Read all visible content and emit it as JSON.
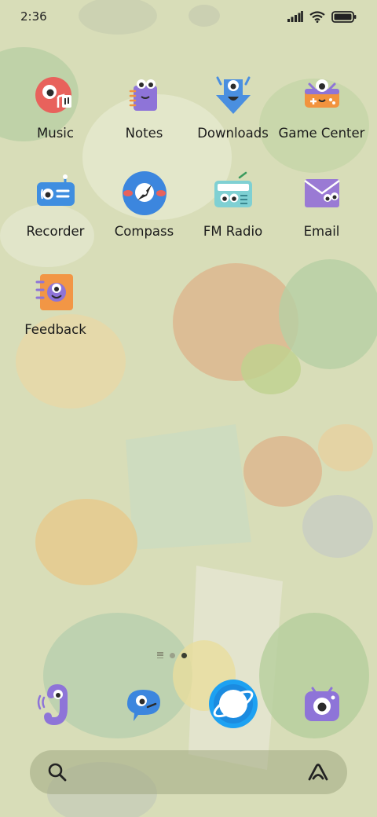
{
  "status_bar": {
    "time": "2:36",
    "icons": [
      "signal-icon",
      "wifi-icon",
      "battery-icon"
    ]
  },
  "apps": [
    {
      "label": "Music",
      "icon": "music-icon"
    },
    {
      "label": "Notes",
      "icon": "notes-icon"
    },
    {
      "label": "Downloads",
      "icon": "downloads-icon"
    },
    {
      "label": "Game Center",
      "icon": "game-center-icon"
    },
    {
      "label": "Recorder",
      "icon": "recorder-icon"
    },
    {
      "label": "Compass",
      "icon": "compass-icon"
    },
    {
      "label": "FM Radio",
      "icon": "fm-radio-icon"
    },
    {
      "label": "Email",
      "icon": "email-icon"
    },
    {
      "label": "Feedback",
      "icon": "feedback-icon"
    }
  ],
  "page_indicator": {
    "pages": 2,
    "current": 2
  },
  "dock": [
    {
      "icon": "phone-icon"
    },
    {
      "icon": "messages-icon"
    },
    {
      "icon": "browser-icon"
    },
    {
      "icon": "camera-icon"
    }
  ],
  "search_bar": {
    "icons": [
      "search-icon",
      "assistant-icon"
    ]
  },
  "colors": {
    "wallpaper": "#d6dcb6",
    "music": "#e8625c",
    "notes": "#8e74d8",
    "downloads": "#4a8fe0",
    "game_center": "#f2933e",
    "recorder": "#3f8ee0",
    "compass": "#3c86de",
    "fm_radio": "#7fd0d3",
    "email": "#9a7ad4",
    "feedback": "#f29645"
  }
}
